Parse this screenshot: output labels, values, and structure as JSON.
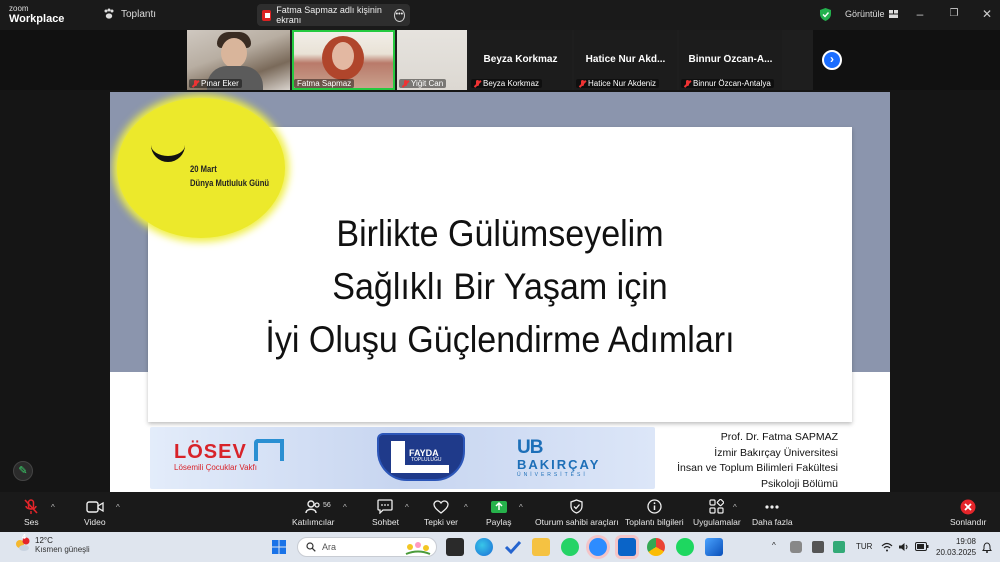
{
  "app": {
    "brand_top": "zoom",
    "brand_bottom": "Workplace",
    "meeting_label": "Toplantı"
  },
  "share_banner": {
    "text": "Fatma Sapmaz adlı kişinin ekranı"
  },
  "top_right": {
    "view_label": "Görüntüle"
  },
  "participants": [
    {
      "name": "Pınar Eker",
      "muted": true
    },
    {
      "name": "Fatma Sapmaz",
      "muted": false,
      "active_speaker": true
    },
    {
      "name": "Yiğit Can",
      "muted": true
    },
    {
      "name": "Beyza Korkmaz",
      "display": "Beyza Korkmaz",
      "muted": true
    },
    {
      "name": "Hatice Nur Akdeniz",
      "display": "Hatice Nur Akd...",
      "muted": true
    },
    {
      "name": "Binnur Özcan-Antalya",
      "display": "Binnur Özcan-A...",
      "muted": true
    }
  ],
  "slide": {
    "badge_line1": "20 Mart",
    "badge_line2": "Dünya Mutluluk Günü",
    "title_line1": "Birlikte Gülümseyelim",
    "title_line2": "Sağlıklı Bir Yaşam için",
    "title_line3": "İyi Oluşu Güçlendirme Adımları",
    "logo_losev": "LÖSEV",
    "logo_losev_sub": "Lösemili Çocuklar Vakfı",
    "logo_fayda": "FAYDA",
    "logo_fayda_sub": "TOPLULUĞU",
    "logo_bakircay_ub": "UB",
    "logo_bakircay": "BAKIRÇAY",
    "logo_bakircay_sub": "ÜNİVERSİTESİ",
    "author": [
      "Prof. Dr. Fatma SAPMAZ",
      "İzmir Bakırçay Üniversitesi",
      "İnsan ve Toplum Bilimleri Fakültesi",
      "Psikoloji Bölümü"
    ]
  },
  "toolbar": {
    "audio": "Ses",
    "video": "Video",
    "participants": "Katılımcılar",
    "participants_count": "56",
    "chat": "Sohbet",
    "react": "Tepki ver",
    "share": "Paylaş",
    "host_tools": "Oturum sahibi araçları",
    "meeting_info": "Toplantı bilgileri",
    "apps": "Uygulamalar",
    "more": "Daha fazla",
    "end": "Sonlandır"
  },
  "taskbar": {
    "weather_badge": "4",
    "weather_temp": "12°C",
    "weather_desc": "Kısmen güneşli",
    "search_placeholder": "Ara",
    "language": "TUR",
    "time": "19:08",
    "date": "20.03.2025"
  },
  "colors": {
    "accent_green": "#25c93f",
    "zoom_blue": "#1a6dff",
    "end_red": "#e5252a",
    "slide_bg": "#8b95ad",
    "sun_yellow": "#ece92b"
  }
}
